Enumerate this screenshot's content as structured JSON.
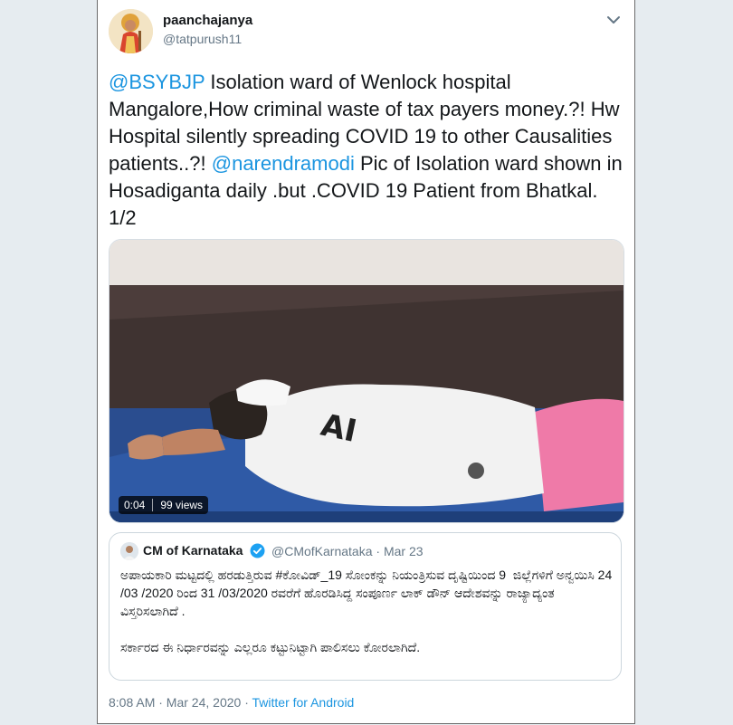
{
  "author": {
    "display_name": "paanchajanya",
    "handle": "@tatpurush11"
  },
  "tweet": {
    "mention_1": "@BSYBJP",
    "text_1": " Isolation ward of Wenlock hospital Mangalore,How criminal waste of tax payers money.?! Hw Hospital silently spreading COVID 19 to other Causalities patients..?! ",
    "mention_2": "@narendramodi",
    "text_2": "  Pic of Isolation ward shown in Hosadiganta daily .but .COVID 19 Patient from Bhatkal. 1/2"
  },
  "video": {
    "duration": "0:04",
    "views": "99 views"
  },
  "quoted_tweet": {
    "display_name": "CM of Karnataka",
    "handle": "@CMofKarnataka",
    "separator": " · ",
    "date": "Mar 23",
    "body": "ಅಪಾಯಕಾರಿ ಮಟ್ಟದಲ್ಲಿ ಹರಡುತ್ತಿರುವ #ಕೋವಿಡ್_19 ಸೋಂಕನ್ನು ನಿಯಂತ್ರಿಸುವ ದೃಷ್ಟಿಯಿಂದ 9  ಜಿಲ್ಲೆಗಳಿಗೆ ಅನ್ವಯಿಸಿ 24 /03 /2020 ರಿಂದ 31 /03/2020 ರವರೆಗೆ ಹೊರಡಿಸಿದ್ದ ಸಂಪೂರ್ಣ ಲಾಕ್ ಡೌನ್ ಆದೇಶವನ್ನು ರಾಜ್ಯಾದ್ಯಂತ ವಿಸ್ತರಿಸಲಾಗಿದೆ .\n\nಸರ್ಕಾರದ ಈ ನಿರ್ಧಾರವನ್ನು ಎಲ್ಲರೂ ಕಟ್ಟುನಿಟ್ಟಾಗಿ ಪಾಲಿಸಲು ಕೋರಲಾಗಿದೆ."
  },
  "footer": {
    "timestamp": "8:08 AM · Mar 24, 2020",
    "separator": " · ",
    "source": "Twitter for Android"
  },
  "icons": {
    "caret": "chevron-down-icon",
    "verified": "verified-badge-icon"
  },
  "colors": {
    "link": "#1b95e0",
    "secondary_text": "#657786",
    "verified": "#1da1f2"
  }
}
